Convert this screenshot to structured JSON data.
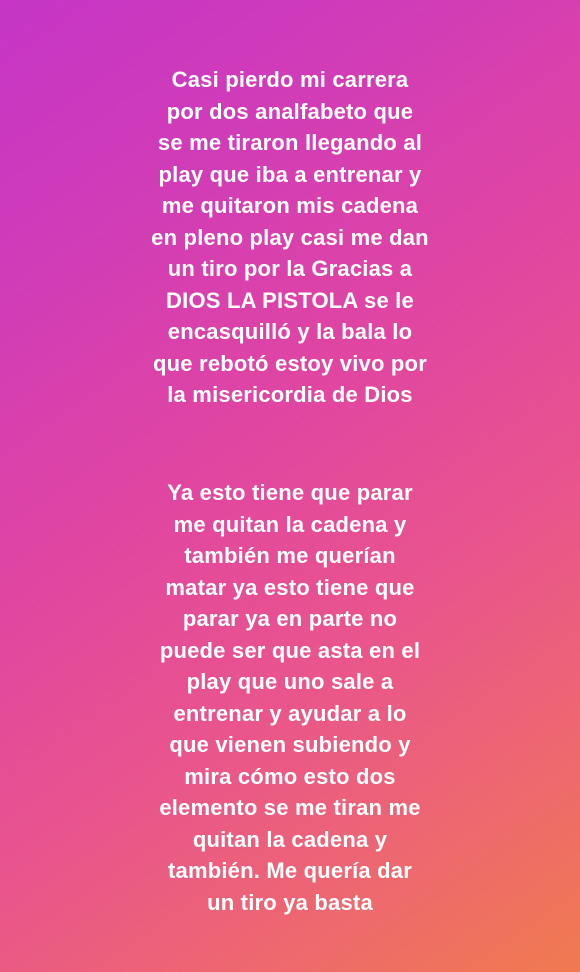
{
  "story": {
    "paragraph_1": [
      "Casi pierdo mi carrera",
      "por dos analfabeto que",
      "se me tiraron llegando al",
      "play que iba a entrenar y",
      "me quitaron mis cadena",
      "en pleno play casi me dan",
      "un tiro por la Gracias a",
      "DIOS LA PISTOLA se le",
      "encasquilló y la bala lo",
      "que rebotó estoy vivo por",
      "la misericordia de Dios"
    ],
    "paragraph_2": [
      "Ya esto tiene que parar",
      "me quitan la cadena y",
      "también me querían",
      "matar ya esto tiene que",
      "parar ya en parte no",
      "puede ser que asta en el",
      "play que uno sale a",
      "entrenar y ayudar a lo",
      "que vienen subiendo y",
      "mira cómo esto dos",
      "elemento se me tiran me",
      "quitan la cadena y",
      "también. Me quería dar",
      "un tiro ya basta"
    ]
  }
}
